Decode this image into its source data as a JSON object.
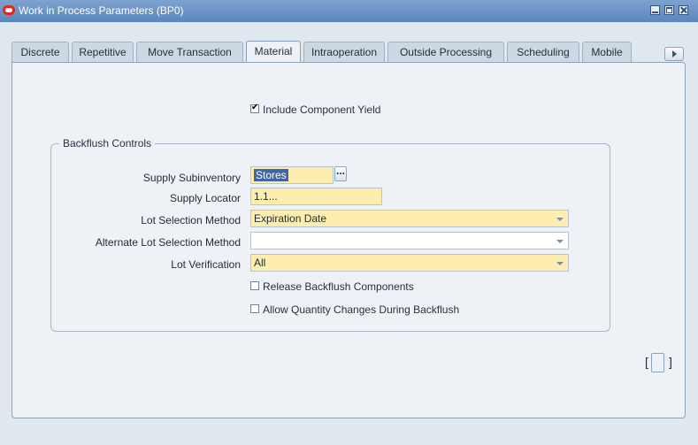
{
  "window": {
    "title": "Work in Process Parameters (BP0)"
  },
  "tabs": [
    {
      "label": "Discrete",
      "active": false
    },
    {
      "label": "Repetitive",
      "active": false
    },
    {
      "label": "Move Transaction",
      "active": false
    },
    {
      "label": "Material",
      "active": true
    },
    {
      "label": "Intraoperation",
      "active": false
    },
    {
      "label": "Outside Processing",
      "active": false
    },
    {
      "label": "Scheduling",
      "active": false
    },
    {
      "label": "Mobile",
      "active": false
    }
  ],
  "include_component_yield": {
    "label": "Include Component Yield",
    "checked": true
  },
  "backflush": {
    "group_title": "Backflush Controls",
    "supply_subinventory": {
      "label": "Supply Subinventory",
      "value": "Stores"
    },
    "supply_locator": {
      "label": "Supply Locator",
      "value": "1.1..."
    },
    "lot_selection_method": {
      "label": "Lot Selection Method",
      "value": "Expiration Date"
    },
    "alternate_lot_selection_method": {
      "label": "Alternate Lot Selection Method",
      "value": ""
    },
    "lot_verification": {
      "label": "Lot Verification",
      "value": "All"
    },
    "release_backflush_components": {
      "label": "Release Backflush Components",
      "checked": false
    },
    "allow_quantity_changes": {
      "label": "Allow Quantity Changes During Backflush",
      "checked": false
    }
  },
  "descriptive_flexfield": {
    "open_bracket": "[",
    "close_bracket": "]"
  }
}
